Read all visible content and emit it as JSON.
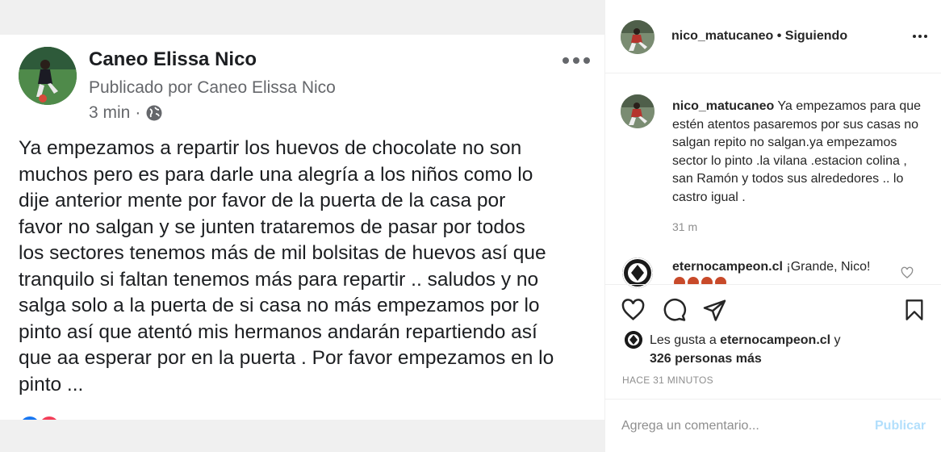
{
  "facebook_post": {
    "author": "Caneo Elissa Nico",
    "published_by": "Publicado por Caneo Elissa Nico",
    "time": "3 min",
    "separator": "·",
    "privacy_icon": "globe-icon",
    "more_icon": "more-horizontal-icon",
    "body": "Ya empezamos a repartir los huevos de chocolate no son\nmuchos pero  es para darle una alegría a los niños como lo\ndije anterior mente por favor de la puerta de la casa por\nfavor no salgan y se junten trataremos de pasar por todos\nlos sectores tenemos más de mil bolsitas de huevos así que\ntranquilo si faltan tenemos más para repartir .. saludos y no\nsalga solo a la puerta de si casa no más empezamos por lo\npinto así que atentó mis hermanos andarán repartiendo así\nque aa esperar por en la puerta . Por favor empezamos en lo\npinto ..."
  },
  "instagram": {
    "header": {
      "username": "nico_matucaneo",
      "separator": " • ",
      "follow_status": "Siguiendo",
      "more_icon": "more-horizontal-icon"
    },
    "caption": {
      "username": "nico_matucaneo",
      "text": " Ya empezamos para que estén atentos pasaremos por sus casas no salgan repito no salgan.ya empezamos sector lo pinto .la vilana .estacion colina , san Ramón y todos sus alrededores .. lo castro igual .",
      "time": "31 m"
    },
    "comment": {
      "username": "eternocampeon.cl",
      "text": " ¡Grande, Nico!",
      "like_icon": "heart-icon"
    },
    "actions": {
      "like_icon": "heart-icon",
      "comment_icon": "comment-bubble-icon",
      "share_icon": "paper-plane-icon",
      "save_icon": "bookmark-icon"
    },
    "likes": {
      "prefix": "Les gusta a ",
      "user": "eternocampeon.cl",
      "middle": " y ",
      "others": "326 personas más"
    },
    "posted_ago": "HACE 31 MINUTOS",
    "add_comment": {
      "placeholder": "Agrega un comentario...",
      "publish_label": "Publicar"
    },
    "colors": {
      "text": "#262626",
      "secondary": "#8e8e8e",
      "publish_disabled": "#b2dffc",
      "divider": "#efefef"
    }
  }
}
